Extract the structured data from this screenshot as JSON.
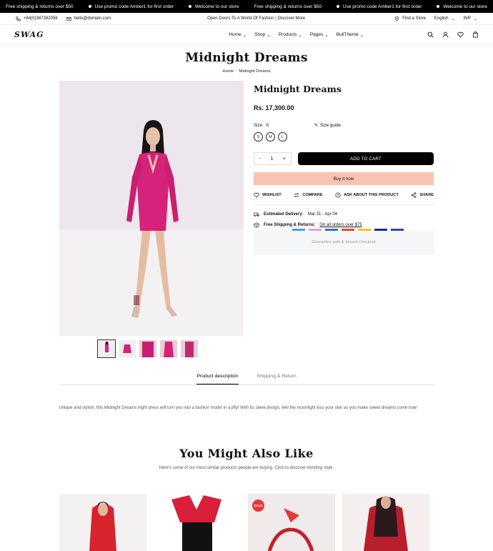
{
  "marquee": [
    "Free shipping & returns over $50",
    "Use promo code Amber1 for first order",
    "Welcome to our store",
    "Free shipping & returns over $50",
    "Use promo code Amber1 for first order",
    "Welcome to our store"
  ],
  "topbar": {
    "phone": "+84(0)387382056",
    "email": "hello@domain.com",
    "announcement": "Open Doors To A World Of Fashion | Discover More",
    "store": "Find a Store",
    "language": "English",
    "currency": "INR"
  },
  "nav": {
    "logo": "SWAG",
    "menu": [
      "Home",
      "Shop",
      "Products",
      "Pages",
      "BullTheme"
    ]
  },
  "page": {
    "title": "Midnight Dreams",
    "breadcrumb": [
      "Home",
      "Midnight Dreams"
    ]
  },
  "product": {
    "name": "Midnight Dreams",
    "price": "Rs. 17,300.00",
    "size_label": "Size : S",
    "size_guide": "Size guide",
    "sizes": [
      "S",
      "M",
      "L"
    ],
    "qty_minus": "-",
    "qty": "1",
    "qty_plus": "+",
    "add_to_cart": "ADD TO CART",
    "buy_now": "Buy it now",
    "actions": [
      "WISHLIST",
      "COMPARE",
      "ASK ABOUT THIS PRODUCT",
      "SHARE"
    ],
    "delivery_label": "Estimated Delivery:",
    "delivery_value": "Mar 31 - Apr 04",
    "shipping_label": "Free Shipping & Returns:",
    "shipping_value": "On all orders over $75",
    "secure_text": "Guarantee safe & secure checkout"
  },
  "tabs": [
    "Product description",
    "Shipping & Return"
  ],
  "description": "Unique and stylish, this Midnight Dreams night dress will turn you into a fashion model in a jiffy! With its sleek design, feel the moonlight kiss your skin as you make sweet dreams come true!",
  "related": {
    "title": "You Might Also Like",
    "subtitle": "Here's some of our most similar products people are buying. Click to discover trending style.",
    "sale_badge": "SALE"
  },
  "colors": {
    "accent": "#f8c3b0",
    "dress": "#d6237a",
    "sale": "#e23a3a"
  }
}
